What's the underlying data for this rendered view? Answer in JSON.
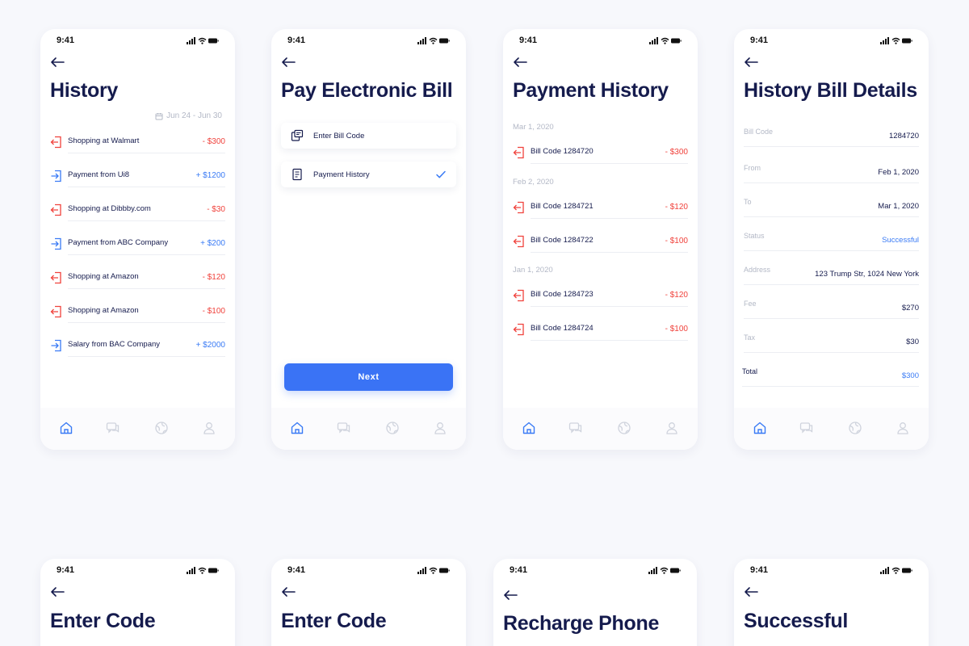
{
  "status": {
    "time": "9:41"
  },
  "colors": {
    "navy": "#151b4d",
    "negative": "#f0423c",
    "positive": "#3a7bf5",
    "button": "#3a73f5",
    "muted": "#b3b8c6"
  },
  "screens": {
    "history": {
      "title": "History",
      "date_range": "Jun 24 - Jun 30",
      "items": [
        {
          "label": "Shopping at Walmart",
          "amount": "- $300",
          "type": "out"
        },
        {
          "label": "Payment from Ui8",
          "amount": "+ $1200",
          "type": "in"
        },
        {
          "label": "Shopping at Dibbby.com",
          "amount": "- $30",
          "type": "out"
        },
        {
          "label": "Payment from ABC Company",
          "amount": "+ $200",
          "type": "in"
        },
        {
          "label": "Shopping at Amazon",
          "amount": "- $120",
          "type": "out"
        },
        {
          "label": "Shopping at Amazon",
          "amount": "- $100",
          "type": "out"
        },
        {
          "label": "Salary from BAC Company",
          "amount": "+ $2000",
          "type": "in"
        }
      ]
    },
    "pay_bill": {
      "title": "Pay Electronic Bill",
      "options": [
        {
          "label": "Enter Bill Code",
          "icon": "bill-code-icon",
          "selected": false
        },
        {
          "label": "Payment History",
          "icon": "receipt-icon",
          "selected": true
        }
      ],
      "next_label": "Next"
    },
    "payment_history": {
      "title": "Payment History",
      "groups": [
        {
          "date": "Mar 1, 2020",
          "items": [
            {
              "label": "Bill Code 1284720",
              "amount": "- $300"
            }
          ]
        },
        {
          "date": "Feb 2, 2020",
          "items": [
            {
              "label": "Bill Code 1284721",
              "amount": "- $120"
            },
            {
              "label": "Bill Code 1284722",
              "amount": "- $100"
            }
          ]
        },
        {
          "date": "Jan 1, 2020",
          "items": [
            {
              "label": "Bill Code 1284723",
              "amount": "- $120"
            },
            {
              "label": "Bill Code 1284724",
              "amount": "- $100"
            }
          ]
        }
      ]
    },
    "bill_details": {
      "title": "History Bill Details",
      "rows": [
        {
          "key": "Bill Code",
          "value": "1284720"
        },
        {
          "key": "From",
          "value": "Feb 1, 2020"
        },
        {
          "key": "To",
          "value": "Mar 1, 2020"
        },
        {
          "key": "Status",
          "value": "Successful"
        },
        {
          "key": "Address",
          "value": "123 Trump Str, 1024 New York"
        },
        {
          "key": "Fee",
          "value": "$270"
        },
        {
          "key": "Tax",
          "value": "$30"
        },
        {
          "key": "Total",
          "value": "$300"
        }
      ]
    },
    "enter_code_1": {
      "title": "Enter Code"
    },
    "enter_code_2": {
      "title": "Enter Code"
    },
    "recharge_phone": {
      "title": "Recharge Phone"
    },
    "successful": {
      "title": "Successful"
    }
  },
  "tabbar": [
    {
      "icon": "home-icon",
      "active": true
    },
    {
      "icon": "chat-icon",
      "active": false
    },
    {
      "icon": "globe-icon",
      "active": false
    },
    {
      "icon": "profile-icon",
      "active": false
    }
  ]
}
